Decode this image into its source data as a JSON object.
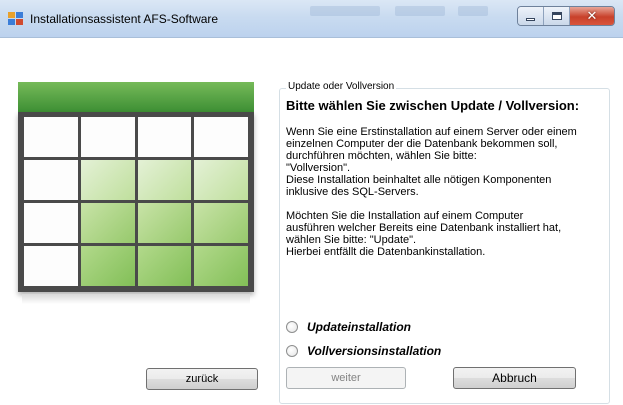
{
  "window": {
    "title": "Installationsassistent AFS-Software",
    "icons": {
      "app": "installer-app-icon",
      "minimize": "minimize-icon",
      "maximize": "maximize-icon",
      "close": "close-icon"
    }
  },
  "group": {
    "legend": "Update oder Vollversion",
    "heading": "Bitte wählen Sie zwischen Update / Vollversion:",
    "description": "Wenn Sie eine Erstinstallation auf einem Server oder einem\neinzelnen Computer der die Datenbank bekommen soll,\ndurchführen möchten, wählen Sie bitte:\n\"Vollversion\".\nDiese Installation beinhaltet alle nötigen Komponenten\ninklusive des SQL-Servers.\n\nMöchten Sie die Installation auf einem Computer\nausführen welcher Bereits eine Datenbank installiert hat,\nwählen Sie bitte: \"Update\".\nHierbei entfällt die Datenbankinstallation."
  },
  "options": [
    {
      "label": "Updateinstallation",
      "selected": false
    },
    {
      "label": "Vollversionsinstallation",
      "selected": false
    }
  ],
  "buttons": {
    "back": "zurück",
    "next": "weiter",
    "cancel": "Abbruch"
  },
  "colors": {
    "hero_green": "#3d8f34",
    "titlebar": "#c9dbf0",
    "close_red": "#c8412b"
  }
}
